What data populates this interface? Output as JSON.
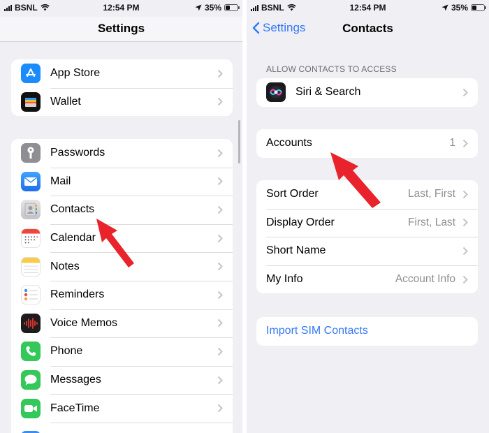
{
  "status": {
    "carrier": "BSNL",
    "time": "12:54 PM",
    "battery": "35%",
    "battery_level": 0.35
  },
  "left": {
    "title": "Settings",
    "group1": [
      {
        "label": "App Store",
        "icon": "app-store-icon",
        "color": "#1a8cff"
      },
      {
        "label": "Wallet",
        "icon": "wallet-icon",
        "color": "#111111"
      }
    ],
    "group2": [
      {
        "label": "Passwords",
        "icon": "key-icon",
        "color": "#8e8e93"
      },
      {
        "label": "Mail",
        "icon": "mail-icon",
        "color": "#2a8cf2"
      },
      {
        "label": "Contacts",
        "icon": "contacts-icon",
        "color": "#c8c8cc"
      },
      {
        "label": "Calendar",
        "icon": "calendar-icon",
        "color": "#ffffff"
      },
      {
        "label": "Notes",
        "icon": "notes-icon",
        "color": "#ffffff"
      },
      {
        "label": "Reminders",
        "icon": "reminders-icon",
        "color": "#ffffff"
      },
      {
        "label": "Voice Memos",
        "icon": "voice-memos-icon",
        "color": "#1c1c1e"
      },
      {
        "label": "Phone",
        "icon": "phone-icon",
        "color": "#34c759"
      },
      {
        "label": "Messages",
        "icon": "messages-icon",
        "color": "#34c759"
      },
      {
        "label": "FaceTime",
        "icon": "facetime-icon",
        "color": "#34c759"
      }
    ]
  },
  "right": {
    "back_label": "Settings",
    "title": "Contacts",
    "section_header": "ALLOW CONTACTS TO ACCESS",
    "siri": {
      "label": "Siri & Search"
    },
    "accounts": {
      "label": "Accounts",
      "value": "1"
    },
    "options": [
      {
        "label": "Sort Order",
        "value": "Last, First"
      },
      {
        "label": "Display Order",
        "value": "First, Last"
      },
      {
        "label": "Short Name",
        "value": ""
      },
      {
        "label": "My Info",
        "value": "Account Info"
      }
    ],
    "import_label": "Import SIM Contacts"
  },
  "colors": {
    "accent": "#3478f6",
    "annotation_arrow": "#e8232b",
    "background": "#efeff4"
  }
}
